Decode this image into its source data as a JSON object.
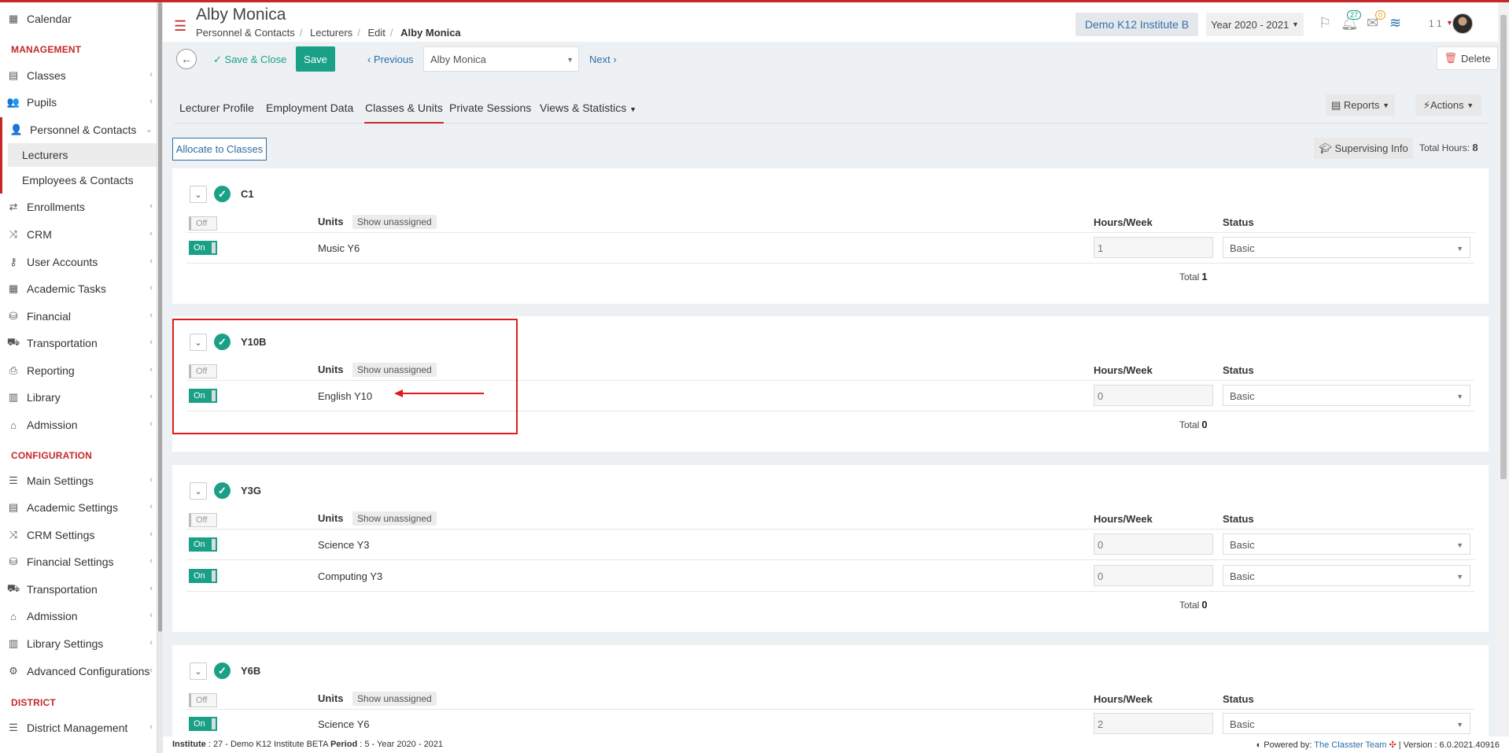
{
  "sidebar": {
    "top_item": "Calendar",
    "sections": {
      "management": "MANAGEMENT",
      "configuration": "CONFIGURATION",
      "district": "DISTRICT"
    },
    "management": [
      "Classes",
      "Pupils",
      "Personnel & Contacts"
    ],
    "personnel_sub": [
      "Lecturers",
      "Employees & Contacts"
    ],
    "management_rest": [
      "Enrollments",
      "CRM",
      "User Accounts",
      "Academic Tasks",
      "Financial",
      "Transportation",
      "Reporting",
      "Library",
      "Admission"
    ],
    "configuration": [
      "Main Settings",
      "Academic Settings",
      "CRM Settings",
      "Financial Settings",
      "Transportation",
      "Admission",
      "Library Settings",
      "Advanced Configurations"
    ],
    "district": [
      "District Management"
    ]
  },
  "header": {
    "title": "Alby Monica",
    "breadcrumb": [
      "Personnel & Contacts",
      "Lecturers",
      "Edit",
      "Alby Monica"
    ],
    "institute": "Demo K12 Institute B",
    "year": "Year 2020 - 2021",
    "notifications_count": "27",
    "messages_count": "0",
    "user_short": "1 1"
  },
  "toolbar": {
    "save_close": "Save & Close",
    "save": "Save",
    "previous": "Previous",
    "current_record": "Alby Monica",
    "next": "Next",
    "delete": "Delete"
  },
  "tabs": [
    "Lecturer Profile",
    "Employment Data",
    "Classes & Units",
    "Private Sessions",
    "Views & Statistics"
  ],
  "reports_label": "Reports",
  "actions_label": "Actions",
  "allocate_label": "Allocate to Classes",
  "supervising_label": "Supervising Info",
  "total_hours_label": "Total Hours:",
  "total_hours_value": "8",
  "labels": {
    "off": "Off",
    "on": "On",
    "units": "Units",
    "show_unassigned": "Show unassigned",
    "hours_week": "Hours/Week",
    "status": "Status",
    "total": "Total"
  },
  "classes": [
    {
      "name": "C1",
      "units": [
        {
          "name": "Music Y6",
          "hours": "1",
          "status": "Basic"
        }
      ],
      "total": "1"
    },
    {
      "name": "Y10B",
      "units": [
        {
          "name": "English Y10",
          "hours": "0",
          "status": "Basic"
        }
      ],
      "total": "0"
    },
    {
      "name": "Y3G",
      "units": [
        {
          "name": "Science Y3",
          "hours": "0",
          "status": "Basic"
        },
        {
          "name": "Computing Y3",
          "hours": "0",
          "status": "Basic"
        }
      ],
      "total": "0"
    },
    {
      "name": "Y6B",
      "units": [
        {
          "name": "Science Y6",
          "hours": "2",
          "status": "Basic"
        }
      ],
      "total": ""
    }
  ],
  "footer": {
    "institute_label": "Institute",
    "institute_value": " : 27 - Demo K12 Institute BETA ",
    "period_label": "Period",
    "period_value": " : 5 - Year 2020 - 2021",
    "powered_by": "Powered by:",
    "team": "The Classter Team",
    "version": "| Version : 6.0.2021.40916"
  },
  "colors": {
    "accent": "#1aa086",
    "brand_red": "#c62828",
    "link": "#2a6ea6"
  }
}
